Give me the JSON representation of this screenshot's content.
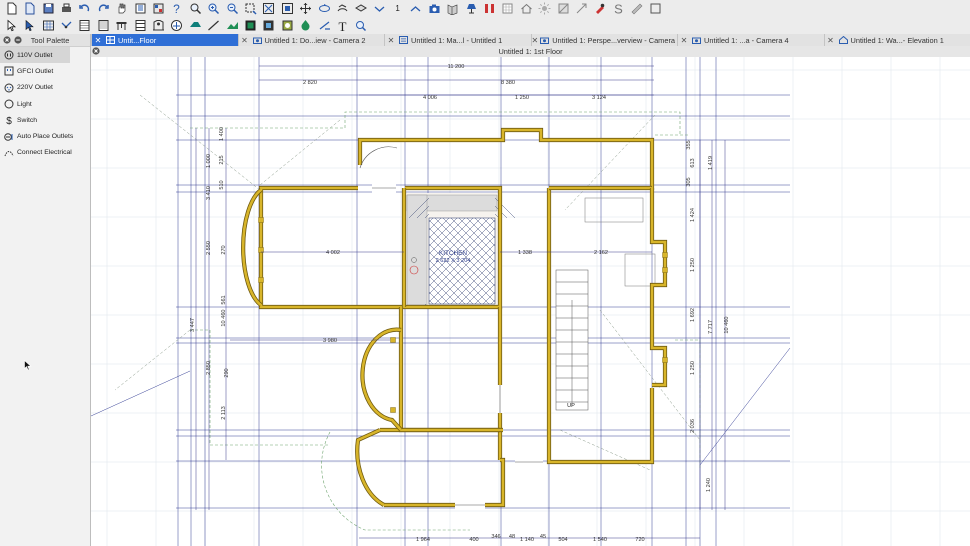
{
  "toolbar_row1_icons": [
    "new-file-icon",
    "new-plan-icon",
    "save-icon",
    "print-icon",
    "undo-icon",
    "redo-icon",
    "select-hand-icon",
    "library-icon",
    "catalog-icon",
    "help-icon",
    "zoom-magnifier-icon",
    "zoom-in-icon",
    "zoom-out-icon",
    "zoom-window-icon",
    "fill-window-icon",
    "fit-icon",
    "pan-icon",
    "swoop-icon",
    "orbit-icon",
    "back-clip-icon",
    "floor-down-icon",
    "floor-label-icon",
    "floor-up-icon",
    "camera-icon",
    "perspective-icon",
    "lamp-icon",
    "measure-icon",
    "grid-icon",
    "home-icon",
    "sun-icon",
    "material-icon",
    "arrow-icon",
    "paint-icon",
    "eyedropper-icon",
    "ruler-icon",
    "pencil-icon"
  ],
  "toolbar_floor_number": "1",
  "toolbar_row2_icons": [
    "pointer-icon",
    "edit-icon",
    "grid-wall-icon",
    "connect-icon",
    "cabinet-icon",
    "wall-icon",
    "table-icon",
    "window-icon",
    "door-icon",
    "stairs-icon",
    "roof-icon",
    "framing-icon",
    "terrain-icon",
    "line-icon",
    "plant-icon",
    "fixture-icon",
    "electrical-icon",
    "room-icon",
    "text-icon",
    "magnifier-icon"
  ],
  "palette": {
    "title": "Tool Palette",
    "items": [
      {
        "label": "110V Outlet",
        "icon": "outlet-110v-icon",
        "selected": true
      },
      {
        "label": "GFCI Outlet",
        "icon": "outlet-gfci-icon",
        "selected": false
      },
      {
        "label": "220V Outlet",
        "icon": "outlet-220v-icon",
        "selected": false
      },
      {
        "label": "Light",
        "icon": "light-icon",
        "selected": false
      },
      {
        "label": "Switch",
        "icon": "switch-icon",
        "selected": false
      },
      {
        "label": "Auto Place Outlets",
        "icon": "auto-outlets-icon",
        "selected": false
      },
      {
        "label": "Connect Electrical",
        "icon": "connect-electrical-icon",
        "selected": false
      }
    ]
  },
  "tabs": [
    {
      "label": "Untit...Floor",
      "icon": "plan-view-icon",
      "active": true
    },
    {
      "label": "Untitled 1: Do...iew - Camera 2",
      "icon": "camera-view-icon",
      "active": false
    },
    {
      "label": "Untitled 1: Ma...l - Untitled 1",
      "icon": "material-list-icon",
      "active": false
    },
    {
      "label": "Untitled 1: Perspe...verview - Camera 3",
      "icon": "camera-view-icon",
      "active": false
    },
    {
      "label": "Untitled 1: ...a - Camera 4",
      "icon": "camera-view-icon",
      "active": false
    },
    {
      "label": "Untitled 1: Wa...- Elevation 1",
      "icon": "elevation-view-icon",
      "active": false
    }
  ],
  "view_title": "Untitled 1: 1st Floor",
  "dims": {
    "top": [
      "11 200",
      "2 820",
      "8 380",
      "4 006",
      "1 250",
      "3 124"
    ],
    "left": [
      "1 400",
      "1 000",
      "215",
      "510",
      "3 410",
      "2 550",
      "270",
      "561",
      "10 460",
      "3 447",
      "2 850",
      "290",
      "2 113"
    ],
    "right": [
      "355",
      "613",
      "305",
      "1 419",
      "1 424",
      "1 250",
      "1 692",
      "7 717",
      "10 460",
      "1 250",
      "2 036",
      "1 240"
    ],
    "interior": [
      "4 002",
      "1 338",
      "2 162",
      "3 980"
    ],
    "bottom": [
      "1 964",
      "400",
      "346",
      "48",
      "1 140",
      "45",
      "504",
      "1 540",
      "720"
    ]
  },
  "room": {
    "name": "KITCHEN",
    "size": "2 622 X 3 204"
  },
  "stairs_label": "UP",
  "colors": {
    "wall": "#d8b52a",
    "wall_edge": "#6f5a10",
    "dimension": "#3a3a8a",
    "guide": "#1f2a8a",
    "hatch": "#1a2a60",
    "accent": "#2f6fd6"
  }
}
